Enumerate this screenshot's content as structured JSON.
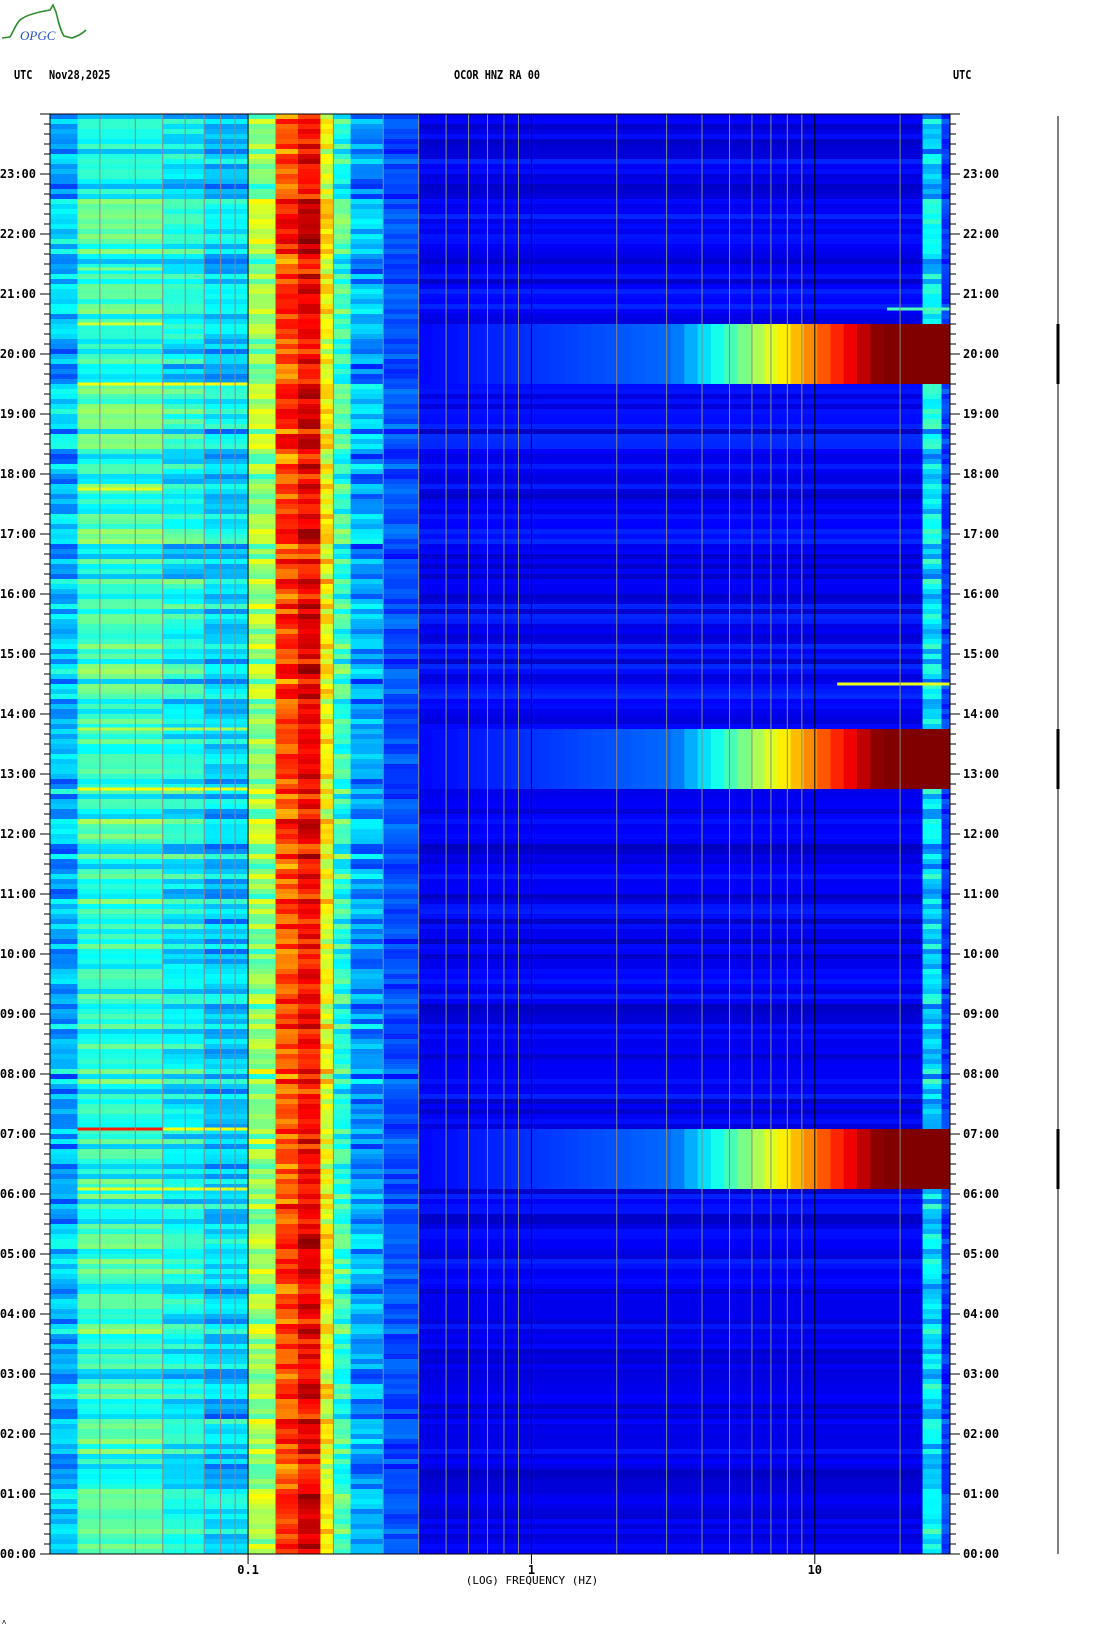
{
  "header": {
    "left_tz": "UTC",
    "date": "Nov28,2025",
    "station": "OCOR HNZ RA 00",
    "right_tz": "UTC"
  },
  "logo": {
    "text": "OPGC"
  },
  "footer_mark": "ʌ",
  "chart_data": {
    "type": "heatmap",
    "title": "OCOR HNZ RA 00",
    "xlabel": "(LOG) FREQUENCY (HZ)",
    "ylabel": "UTC",
    "x_scale": "log",
    "xlim": [
      0.02,
      30
    ],
    "ylim_hours": [
      0,
      24
    ],
    "x_ticks": [
      {
        "value": 0.1,
        "label": "0.1"
      },
      {
        "value": 1,
        "label": "1"
      },
      {
        "value": 10,
        "label": "10"
      }
    ],
    "y_ticks": [
      "00:00",
      "01:00",
      "02:00",
      "03:00",
      "04:00",
      "05:00",
      "06:00",
      "07:00",
      "08:00",
      "09:00",
      "10:00",
      "11:00",
      "12:00",
      "13:00",
      "14:00",
      "15:00",
      "16:00",
      "17:00",
      "18:00",
      "19:00",
      "20:00",
      "21:00",
      "22:00",
      "23:00"
    ],
    "y_minor_tick_minutes": 10,
    "colormap": [
      "#00008f",
      "#0000ff",
      "#0080ff",
      "#00ffff",
      "#80ff80",
      "#ffff00",
      "#ff8000",
      "#ff0000",
      "#800000"
    ],
    "grid": true,
    "background_bands": [
      {
        "f": [
          0.02,
          0.025
        ],
        "level": 0.3
      },
      {
        "f": [
          0.025,
          0.05
        ],
        "level": 0.42
      },
      {
        "f": [
          0.05,
          0.07
        ],
        "level": 0.38
      },
      {
        "f": [
          0.07,
          0.1
        ],
        "level": 0.33
      },
      {
        "f": [
          0.1,
          0.125
        ],
        "level": 0.52
      },
      {
        "f": [
          0.125,
          0.15
        ],
        "level": 0.8
      },
      {
        "f": [
          0.15,
          0.18
        ],
        "level": 0.88
      },
      {
        "f": [
          0.18,
          0.2
        ],
        "level": 0.62
      },
      {
        "f": [
          0.2,
          0.23
        ],
        "level": 0.42
      },
      {
        "f": [
          0.23,
          0.3
        ],
        "level": 0.28
      },
      {
        "f": [
          0.3,
          0.4
        ],
        "level": 0.2
      },
      {
        "f": [
          0.4,
          24
        ],
        "level": 0.11
      },
      {
        "f": [
          24,
          28
        ],
        "level": 0.34
      },
      {
        "f": [
          28,
          30
        ],
        "level": 0.18
      }
    ],
    "events": [
      {
        "start": "19:30",
        "end": "20:30",
        "f_min": 3,
        "peak_f": 18,
        "level": 1.0
      },
      {
        "start": "12:45",
        "end": "13:45",
        "f_min": 3,
        "peak_f": 18,
        "level": 1.0
      },
      {
        "start": "06:05",
        "end": "07:05",
        "f_min": 3,
        "peak_f": 18,
        "level": 1.0
      }
    ],
    "transients": [
      {
        "time": "19:30",
        "f": [
          0.025,
          0.1
        ],
        "level": 0.62
      },
      {
        "time": "20:30",
        "f": [
          0.025,
          0.05
        ],
        "level": 0.58
      },
      {
        "time": "17:45",
        "f": [
          0.025,
          0.05
        ],
        "level": 0.6
      },
      {
        "time": "13:45",
        "f": [
          0.025,
          0.1
        ],
        "level": 0.55
      },
      {
        "time": "12:45",
        "f": [
          0.025,
          0.1
        ],
        "level": 0.62
      },
      {
        "time": "07:05",
        "f": [
          0.025,
          0.05
        ],
        "level": 0.85
      },
      {
        "time": "07:05",
        "f": [
          0.05,
          0.1
        ],
        "level": 0.62
      },
      {
        "time": "06:05",
        "f": [
          0.025,
          0.1
        ],
        "level": 0.6
      },
      {
        "time": "21:25",
        "f": [
          0.025,
          0.05
        ],
        "level": 0.5
      },
      {
        "time": "14:30",
        "f": [
          12,
          30
        ],
        "level": 0.6
      },
      {
        "time": "20:45",
        "f": [
          18,
          30
        ],
        "level": 0.45
      }
    ],
    "trace_segments": [
      {
        "start": "19:30",
        "end": "20:30"
      },
      {
        "start": "12:45",
        "end": "13:45"
      },
      {
        "start": "06:05",
        "end": "07:05"
      }
    ]
  }
}
